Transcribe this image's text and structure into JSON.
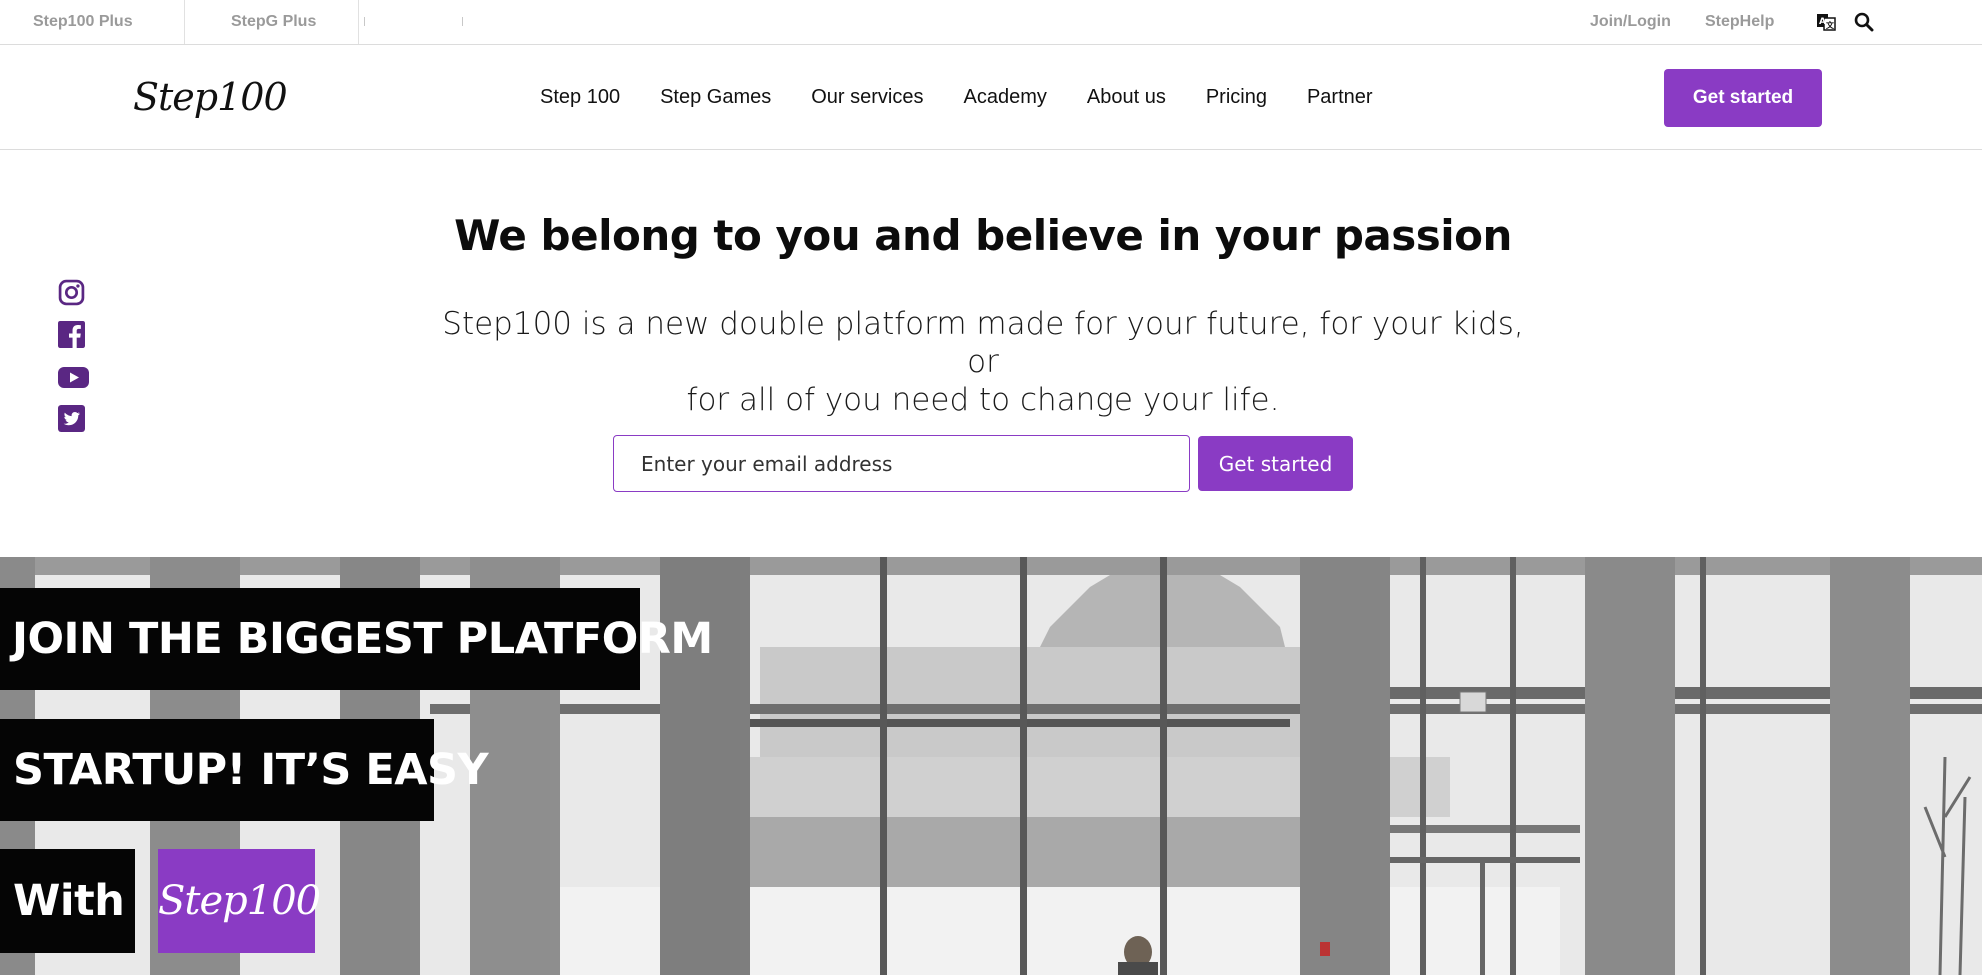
{
  "topbar": {
    "left_links": [
      "Step100 Plus",
      "StepG Plus"
    ],
    "right_links": [
      "Join/Login",
      "StepHelp"
    ],
    "icons": [
      "translate-icon",
      "search-icon"
    ]
  },
  "nav": {
    "logo_text": "Step100",
    "links": [
      "Step 100",
      "Step Games",
      "Our services",
      "Academy",
      "About us",
      "Pricing",
      "Partner"
    ],
    "cta_label": "Get started"
  },
  "hero": {
    "title": "We belong to you and believe in your passion",
    "subtitle_line1": "Step100 is a new double platform made for your future, for your kids, or",
    "subtitle_line2": "for all of you need to change your life.",
    "email_placeholder": "Enter your email address",
    "cta_label": "Get started"
  },
  "social": [
    "instagram-icon",
    "facebook-icon",
    "youtube-icon",
    "twitter-icon"
  ],
  "banner": {
    "line1": "JOIN THE BIGGEST PLATFORM",
    "line2": "STARTUP! IT’S EASY",
    "line3": "With",
    "logo_text": "Step100"
  },
  "colors": {
    "accent": "#8a3bc4",
    "banner_bg": "#050505",
    "muted_text": "#9a9a9a"
  }
}
